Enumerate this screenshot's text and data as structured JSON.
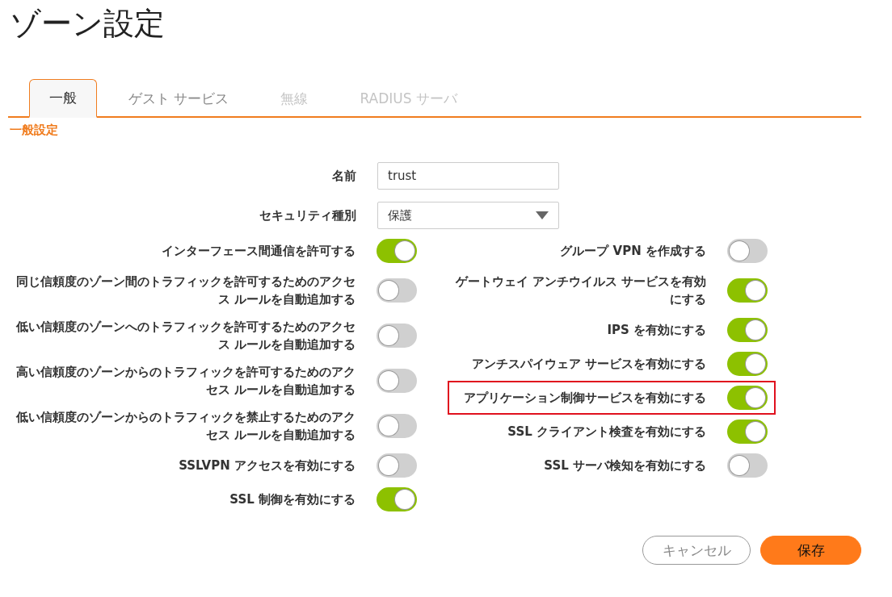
{
  "page": {
    "title": "ゾーン設定"
  },
  "tabs": [
    {
      "label": "一般",
      "selected": true,
      "disabled": false
    },
    {
      "label": "ゲスト サービス",
      "selected": false,
      "disabled": false
    },
    {
      "label": "無線",
      "selected": false,
      "disabled": true
    },
    {
      "label": "RADIUS サーバ",
      "selected": false,
      "disabled": true
    }
  ],
  "section": {
    "title": "一般設定"
  },
  "fields": [
    {
      "kind": "text",
      "label": "名前",
      "value": "trust"
    },
    {
      "kind": "select",
      "label": "セキュリティ種別",
      "value": "保護"
    }
  ],
  "left_toggles": [
    {
      "label": "インターフェース間通信を許可する",
      "on": true,
      "highlighted": false
    },
    {
      "label": "同じ信頼度のゾーン間のトラフィックを許可するためのアクセス ルールを自動追加する",
      "on": false,
      "highlighted": false
    },
    {
      "label": "低い信頼度のゾーンへのトラフィックを許可するためのアクセス ルールを自動追加する",
      "on": false,
      "highlighted": false
    },
    {
      "label": "高い信頼度のゾーンからのトラフィックを許可するためのアクセス ルールを自動追加する",
      "on": false,
      "highlighted": false
    },
    {
      "label": "低い信頼度のゾーンからのトラフィックを禁止するためのアクセス ルールを自動追加する",
      "on": false,
      "highlighted": false
    },
    {
      "label": "SSLVPN アクセスを有効にする",
      "on": false,
      "highlighted": false
    },
    {
      "label": "SSL 制御を有効にする",
      "on": true,
      "highlighted": false
    }
  ],
  "right_toggles": [
    {
      "label": "グループ VPN を作成する",
      "on": false,
      "highlighted": false
    },
    {
      "label": "ゲートウェイ アンチウイルス サービスを有効にする",
      "on": true,
      "highlighted": false
    },
    {
      "label": "IPS を有効にする",
      "on": true,
      "highlighted": false
    },
    {
      "label": "アンチスパイウェア サービスを有効にする",
      "on": true,
      "highlighted": false
    },
    {
      "label": "アプリケーション制御サービスを有効にする",
      "on": true,
      "highlighted": true
    },
    {
      "label": "SSL クライアント検査を有効にする",
      "on": true,
      "highlighted": false
    },
    {
      "label": "SSL サーバ検知を有効にする",
      "on": false,
      "highlighted": false
    }
  ],
  "buttons": [
    {
      "kind": "secondary",
      "label": "キャンセル"
    },
    {
      "kind": "primary",
      "label": "保存"
    }
  ]
}
